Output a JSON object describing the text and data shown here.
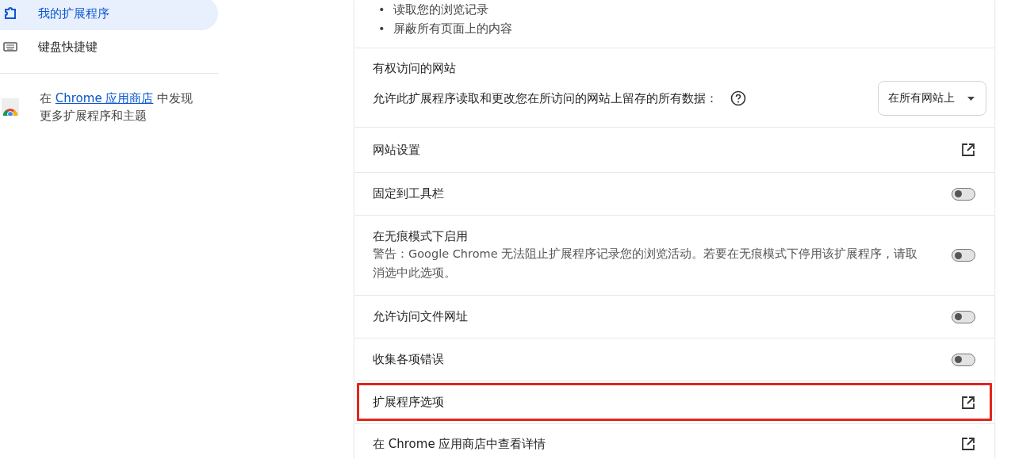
{
  "sidebar": {
    "items": [
      {
        "label": "我的扩展程序",
        "selected": true
      },
      {
        "label": "键盘快捷键",
        "selected": false
      }
    ],
    "promo": {
      "prefix": "在 ",
      "link": "Chrome 应用商店",
      "suffix": " 中发现更多扩展程序和主题"
    }
  },
  "permissions": [
    {
      "marker": "•",
      "text": "读取您的浏览记录"
    },
    {
      "marker": "•",
      "text": "屏蔽所有页面上的内容"
    }
  ],
  "site_access": {
    "heading": "有权访问的网站",
    "label": "允许此扩展程序读取和更改您在所访问的网站上留存的所有数据：",
    "select": {
      "value": "在所有网站上"
    }
  },
  "rows": [
    {
      "kind": "link",
      "label": "网站设置",
      "highlighted": false
    },
    {
      "kind": "toggle",
      "label": "固定到工具栏",
      "on": false,
      "highlighted": false
    },
    {
      "kind": "toggle",
      "label": "在无痕模式下启用",
      "description": "警告：Google Chrome 无法阻止扩展程序记录您的浏览活动。若要在无痕模式下停用该扩展程序，请取消选中此选项。",
      "on": false,
      "highlighted": false
    },
    {
      "kind": "toggle",
      "label": "允许访问文件网址",
      "on": false,
      "highlighted": false
    },
    {
      "kind": "toggle",
      "label": "收集各项错误",
      "on": false,
      "highlighted": false
    },
    {
      "kind": "link",
      "label": "扩展程序选项",
      "highlighted": true
    },
    {
      "kind": "link",
      "label": "在 Chrome 应用商店中查看详情",
      "highlighted": false
    }
  ]
}
